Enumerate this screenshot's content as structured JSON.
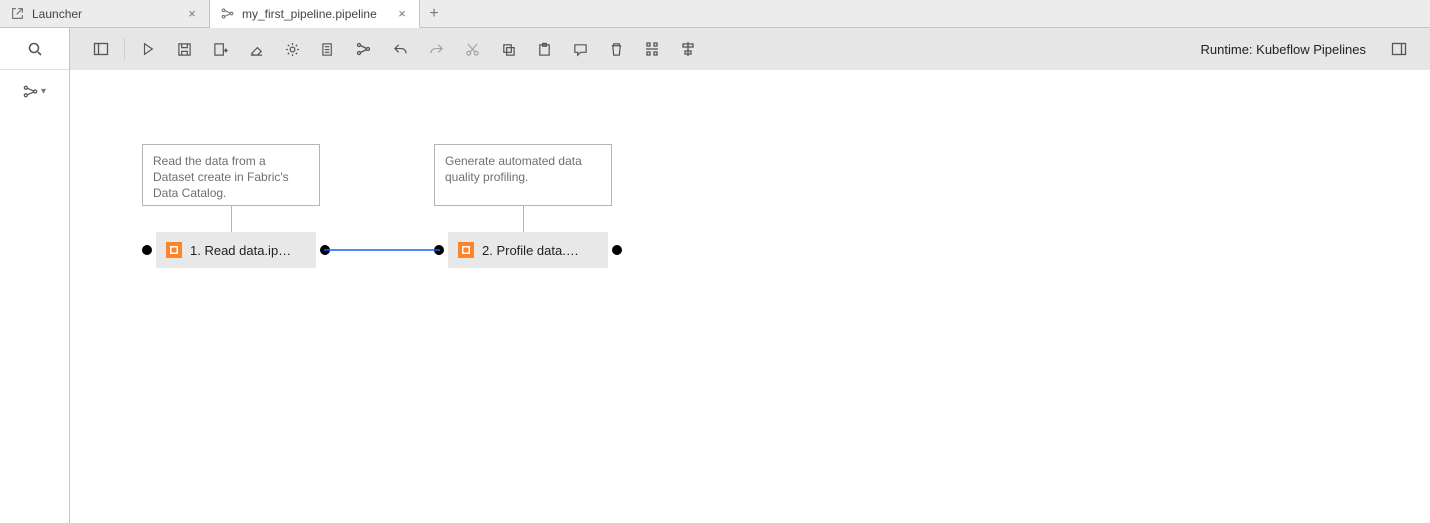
{
  "tabs": [
    {
      "label": "Launcher",
      "icon": "launch-icon",
      "active": false
    },
    {
      "label": "my_first_pipeline.pipeline",
      "icon": "pipeline-icon",
      "active": true
    }
  ],
  "toolbar": {
    "runtime_label": "Runtime: Kubeflow Pipelines",
    "buttons": [
      "toggle-left-panel",
      "run",
      "save",
      "export",
      "clear",
      "properties",
      "new-comment",
      "arrange-h",
      "undo",
      "redo",
      "cut",
      "copy",
      "paste",
      "add-comment",
      "delete",
      "arrange-v",
      "align"
    ]
  },
  "canvas": {
    "comments": [
      {
        "text": "Read the data from a Dataset create in Fabric's Data Catalog."
      },
      {
        "text": "Generate automated data quality profiling."
      }
    ],
    "nodes": [
      {
        "label": "1. Read data.ip…",
        "icon": "notebook-icon"
      },
      {
        "label": "2. Profile data.…",
        "icon": "notebook-icon"
      }
    ]
  },
  "palette": {
    "search_icon": "search-icon",
    "category_icon": "category-icon"
  }
}
